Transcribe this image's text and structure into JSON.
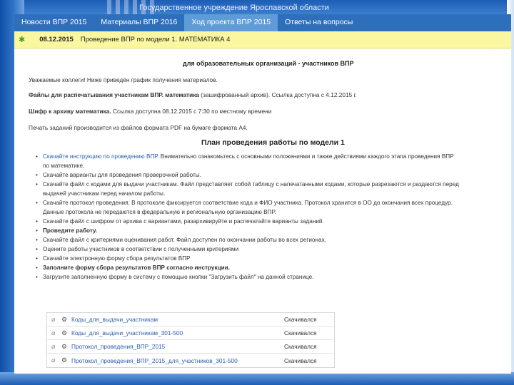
{
  "header": {
    "title": "Государственное учреждение Ярославской области"
  },
  "tabs": [
    {
      "label": "Новости ВПР 2015"
    },
    {
      "label": "Материалы ВПР 2016"
    },
    {
      "label": "Ход проекта ВПР 2015"
    },
    {
      "label": "Ответы на вопросы"
    }
  ],
  "announcement": {
    "date": "08.12.2015",
    "text": "Проведение ВПР по модели 1. МАТЕМАТИКА 4"
  },
  "intro": {
    "subtitle": "для образовательных организаций - участников ВПР",
    "greeting": "Уважаемые коллеги! Ниже приведён график получения материалов.",
    "files_note_bold": "Файлы для распечатывания участникам ВПР. математика",
    "files_note_rest": " (зашифрованный архив). Ссылка доступна с 4.12.2015 г.",
    "cipher_bold": "Шифр к архиву математика.",
    "cipher_rest": " Ссылка доступна 08.12.2015 с 7:30 по местному времени",
    "print_note": "Печать заданий производится из файлов формата PDF на бумаге формата А4."
  },
  "plan": {
    "title": "План проведения работы по модели 1",
    "steps": [
      {
        "link": "Скачайте инструкцию по проведению ВПР.",
        "text": " Внимательно ознакомьтесь с основными положениями и также действиями каждого этапа проведения ВПР",
        "cont": "по математике."
      },
      {
        "link": "",
        "text": "Скачайте варианты для проведения проверочной работы.",
        "cont": ""
      },
      {
        "link": "",
        "text": "Скачайте файл с кодами для выдачи участникам. Файл представляет собой таблицу с напечатанными кодами, которые разрезаются и раздаются перед",
        "cont": "выдачей участникам перед началом работы."
      },
      {
        "link": "",
        "text": "Скачайте протокол проведения. В протоколе фиксируется соответствие кода и ФИО участника. Протокол хранится в ОО до окончания всех процедур.",
        "cont": "Данные протокола не передаются в федеральную и региональную организацию ВПР."
      },
      {
        "link": "",
        "text": "Скачайте файл с шифром от архива с вариантами, разархивируйте и распечатайте варианты заданий.",
        "cont": ""
      },
      {
        "strong": "Проведите работу.",
        "text": "",
        "cont": ""
      },
      {
        "link": "",
        "text": "Скачайте файл с критериями оценивания работ. Файл доступен по окончании работы во всех регионах.",
        "cont": ""
      },
      {
        "link": "",
        "text": "Оцените работы участников в соответствии с полученными критериями",
        "cont": ""
      },
      {
        "link": "",
        "text": "Скачайте электронную форму сбора результатов ВПР",
        "cont": ""
      },
      {
        "strong": "Заполните форму сбора результатов ВПР согласно инструкции.",
        "text": "",
        "cont": ""
      },
      {
        "link": "",
        "text": "Загрузите заполненную форму в систему с помощью кнопки \"Загрузить файл\" на данной странице.",
        "cont": ""
      }
    ]
  },
  "files": [
    {
      "name": "Коды_для_выдачи_участникам",
      "status": "Скачивался"
    },
    {
      "name": "Коды_для_выдачи_участникам_301-500",
      "status": "Скачивался"
    },
    {
      "name": "Протокол_проведения_ВПР_2015",
      "status": "Скачивался"
    },
    {
      "name": "Протокол_проведения_ВПР_2015_для_участников_301-500",
      "status": "Скачивался"
    }
  ],
  "colors": {
    "frame": "#2e6fbd",
    "tab_active": "#5f9bd9",
    "announce_bg": "#fbf7a0",
    "link": "#2a5db0"
  }
}
